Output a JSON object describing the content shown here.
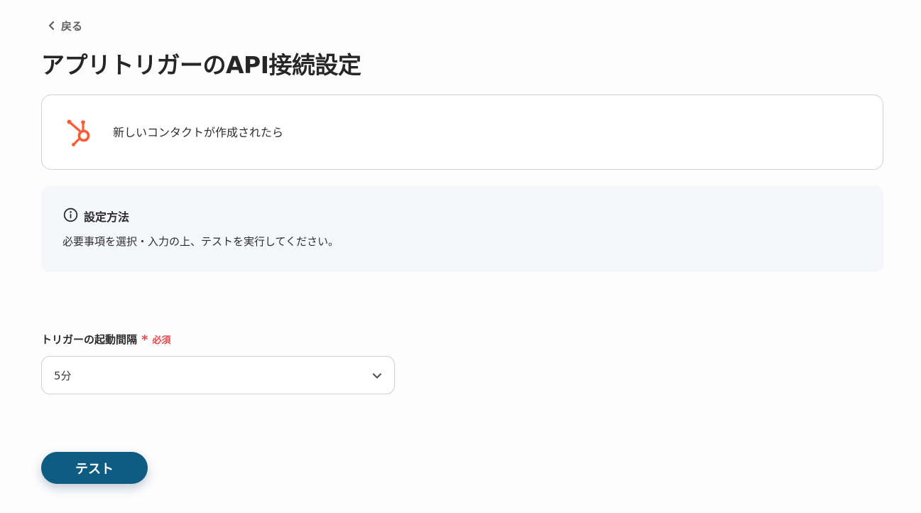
{
  "nav": {
    "back_label": "戻る"
  },
  "page": {
    "title": "アプリトリガーのAPI接続設定"
  },
  "trigger": {
    "app_icon": "hubspot-icon",
    "label": "新しいコンタクトが作成されたら"
  },
  "info": {
    "icon": "info-icon",
    "heading": "設定方法",
    "body": "必要事項を選択・入力の上、テストを実行してください。"
  },
  "interval_field": {
    "label": "トリガーの起動間隔",
    "required_mark": "*",
    "required_text": "必須",
    "value": "5分",
    "chevron_icon": "chevron-down-icon"
  },
  "actions": {
    "test_label": "テスト"
  },
  "colors": {
    "primary": "#0f5c82",
    "hubspot": "#ff5c35",
    "required": "#e5484d",
    "info_bg": "#f5f7fa"
  }
}
